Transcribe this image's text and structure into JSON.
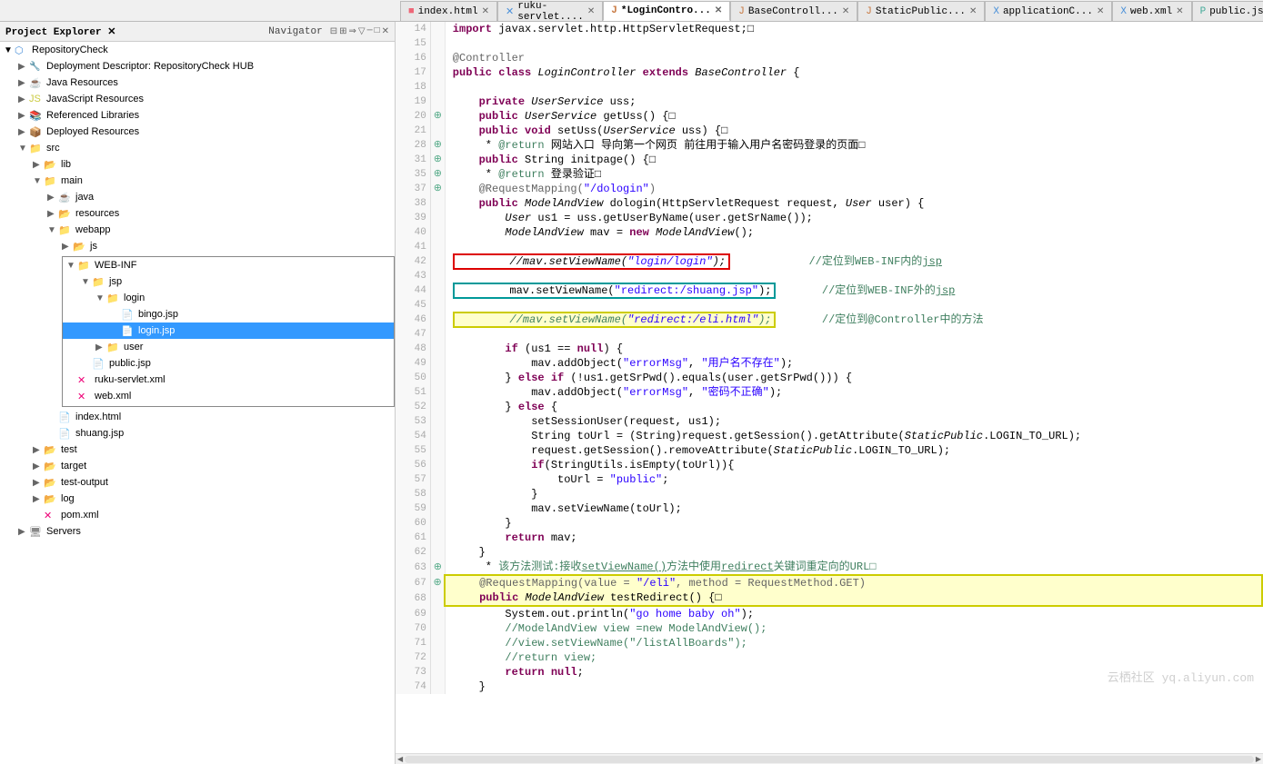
{
  "topbar": {
    "tabs": [
      {
        "label": "index.html",
        "active": false,
        "modified": false
      },
      {
        "label": "ruku-servlet....",
        "active": false,
        "modified": false
      },
      {
        "label": "*LoginContro...",
        "active": true,
        "modified": true
      },
      {
        "label": "BaseControll...",
        "active": false,
        "modified": false
      },
      {
        "label": "StaticPublic...",
        "active": false,
        "modified": false
      },
      {
        "label": "applicationC...",
        "active": false,
        "modified": false
      },
      {
        "label": "web.xml",
        "active": false,
        "modified": false
      },
      {
        "label": "public.jsp",
        "active": false,
        "modified": false
      }
    ]
  },
  "leftpanel": {
    "title": "Project Explorer",
    "project": "RepositoryCheck",
    "items": [
      {
        "level": 1,
        "label": "Deployment Descriptor: RepositoryCheck HUB",
        "type": "deploy",
        "expanded": false
      },
      {
        "level": 1,
        "label": "Java Resources",
        "type": "java",
        "expanded": false
      },
      {
        "level": 1,
        "label": "JavaScript Resources",
        "type": "js",
        "expanded": false
      },
      {
        "level": 1,
        "label": "Referenced Libraries",
        "type": "ref",
        "expanded": false
      },
      {
        "level": 1,
        "label": "Deployed Resources",
        "type": "deploy",
        "expanded": false
      },
      {
        "level": 1,
        "label": "src",
        "type": "folder",
        "expanded": true
      },
      {
        "level": 2,
        "label": "lib",
        "type": "folder",
        "expanded": false
      },
      {
        "level": 2,
        "label": "main",
        "type": "folder",
        "expanded": true
      },
      {
        "level": 3,
        "label": "java",
        "type": "java",
        "expanded": false
      },
      {
        "level": 3,
        "label": "resources",
        "type": "folder",
        "expanded": false
      },
      {
        "level": 3,
        "label": "webapp",
        "type": "folder",
        "expanded": true
      },
      {
        "level": 4,
        "label": "js",
        "type": "folder",
        "expanded": false
      },
      {
        "level": 4,
        "label": "WEB-INF",
        "type": "folder",
        "expanded": true
      },
      {
        "level": 5,
        "label": "jsp",
        "type": "folder",
        "expanded": true
      },
      {
        "level": 6,
        "label": "login",
        "type": "folder",
        "expanded": true
      },
      {
        "level": 7,
        "label": "bingo.jsp",
        "type": "jsp",
        "expanded": false,
        "selected": false
      },
      {
        "level": 7,
        "label": "login.jsp",
        "type": "jsp",
        "expanded": false,
        "selected": true
      },
      {
        "level": 6,
        "label": "user",
        "type": "folder",
        "expanded": false
      },
      {
        "level": 5,
        "label": "public.jsp",
        "type": "jsp",
        "expanded": false
      },
      {
        "level": 4,
        "label": "ruku-servlet.xml",
        "type": "xml",
        "expanded": false
      },
      {
        "level": 4,
        "label": "web.xml",
        "type": "xml",
        "expanded": false
      },
      {
        "level": 3,
        "label": "index.html",
        "type": "html",
        "expanded": false
      },
      {
        "level": 3,
        "label": "shuang.jsp",
        "type": "jsp",
        "expanded": false
      },
      {
        "level": 2,
        "label": "test",
        "type": "folder",
        "expanded": false
      },
      {
        "level": 2,
        "label": "target",
        "type": "folder",
        "expanded": false
      },
      {
        "level": 2,
        "label": "test-output",
        "type": "folder",
        "expanded": false
      },
      {
        "level": 2,
        "label": "log",
        "type": "folder",
        "expanded": false
      },
      {
        "level": 2,
        "label": "pom.xml",
        "type": "xml",
        "expanded": false
      },
      {
        "level": 1,
        "label": "Servers",
        "type": "server",
        "expanded": false
      }
    ]
  },
  "code": {
    "lines": [
      {
        "n": 14,
        "marker": "",
        "text": "import javax.servlet.http.HttpServletRequest;□"
      },
      {
        "n": 15,
        "marker": "",
        "text": ""
      },
      {
        "n": 16,
        "marker": "",
        "text": "@Controller"
      },
      {
        "n": 17,
        "marker": "",
        "text": "public class LoginController extends BaseController {"
      },
      {
        "n": 18,
        "marker": "",
        "text": ""
      },
      {
        "n": 19,
        "marker": "",
        "text": "    private UserService uss;"
      },
      {
        "n": 20,
        "marker": "⊕",
        "text": "    public UserService getUss() {□"
      },
      {
        "n": 21,
        "marker": "",
        "text": "    public void setUss(UserService uss) {□"
      },
      {
        "n": 28,
        "marker": "⊕",
        "text": "     * @return 网站入口 导向第一个网页 前往用于输入用户名密码登录的页面□"
      },
      {
        "n": 31,
        "marker": "⊕",
        "text": "    public String initpage() {□"
      },
      {
        "n": 35,
        "marker": "⊕",
        "text": "     * @return 登录验证□"
      },
      {
        "n": 37,
        "marker": "⊕",
        "text": "    @RequestMapping(\"/dologin\")"
      },
      {
        "n": 38,
        "marker": "",
        "text": "    public ModelAndView dologin(HttpServletRequest request, User user) {"
      },
      {
        "n": 39,
        "marker": "",
        "text": "        User us1 = uss.getUserByName(user.getSrName());"
      },
      {
        "n": 40,
        "marker": "",
        "text": "        ModelAndView mav = new ModelAndView();"
      },
      {
        "n": 41,
        "marker": "",
        "text": ""
      },
      {
        "n": 42,
        "marker": "",
        "text": "        //mav.setViewName(\"login/login\");        //定位到WEB-INF内的jsp",
        "boxRed": true
      },
      {
        "n": 43,
        "marker": "",
        "text": ""
      },
      {
        "n": 44,
        "marker": "",
        "text": "        mav.setViewName(\"redirect:/shuang.jsp\");   //定位到WEB-INF外的jsp",
        "boxTeal": true
      },
      {
        "n": 45,
        "marker": "",
        "text": ""
      },
      {
        "n": 46,
        "marker": "",
        "text": "        //mav.setViewName(\"redirect:/eli.html\");   //定位到@Controller中的方法",
        "boxYellow": true
      },
      {
        "n": 47,
        "marker": "",
        "text": ""
      },
      {
        "n": 48,
        "marker": "",
        "text": "        if (us1 == null) {"
      },
      {
        "n": 49,
        "marker": "",
        "text": "            mav.addObject(\"errorMsg\", \"用户名不存在\");"
      },
      {
        "n": 50,
        "marker": "",
        "text": "        } else if (!us1.getSrPwd().equals(user.getSrPwd())) {"
      },
      {
        "n": 51,
        "marker": "",
        "text": "            mav.addObject(\"errorMsg\", \"密码不正确\");"
      },
      {
        "n": 52,
        "marker": "",
        "text": "        } else {"
      },
      {
        "n": 53,
        "marker": "",
        "text": "            setSessionUser(request, us1);"
      },
      {
        "n": 54,
        "marker": "",
        "text": "            String toUrl = (String)request.getSession().getAttribute(StaticPublic.LOGIN_TO_URL);"
      },
      {
        "n": 55,
        "marker": "",
        "text": "            request.getSession().removeAttribute(StaticPublic.LOGIN_TO_URL);"
      },
      {
        "n": 56,
        "marker": "",
        "text": "            if(StringUtils.isEmpty(toUrl)){"
      },
      {
        "n": 57,
        "marker": "",
        "text": "                toUrl = \"public\";"
      },
      {
        "n": 58,
        "marker": "",
        "text": "            }"
      },
      {
        "n": 59,
        "marker": "",
        "text": "            mav.setViewName(toUrl);"
      },
      {
        "n": 60,
        "marker": "",
        "text": "        }"
      },
      {
        "n": 61,
        "marker": "",
        "text": "        return mav;"
      },
      {
        "n": 62,
        "marker": "",
        "text": "    }"
      },
      {
        "n": 63,
        "marker": "⊕",
        "text": "     * 该方法测试:接收setViewName()方法中使用redirect关键词重定向的URL□"
      },
      {
        "n": 67,
        "marker": "⊕",
        "text": "    @RequestMapping(value = \"/eli\", method = RequestMethod.GET)",
        "boxYellowBlock": true
      },
      {
        "n": 68,
        "marker": "",
        "text": "    public ModelAndView testRedirect() {□",
        "boxYellowBlock": true
      },
      {
        "n": 69,
        "marker": "",
        "text": "        System.out.println(\"go home baby oh\");"
      },
      {
        "n": 70,
        "marker": "",
        "text": "        //ModelAndView view =new ModelAndView();"
      },
      {
        "n": 71,
        "marker": "",
        "text": "        //view.setViewName(\"/listAllBoards\");"
      },
      {
        "n": 72,
        "marker": "",
        "text": "        //return view;"
      },
      {
        "n": 73,
        "marker": "",
        "text": "        return null;"
      },
      {
        "n": 74,
        "marker": "",
        "text": "    }"
      }
    ]
  },
  "watermark": "云栖社区 yq.aliyun.com"
}
